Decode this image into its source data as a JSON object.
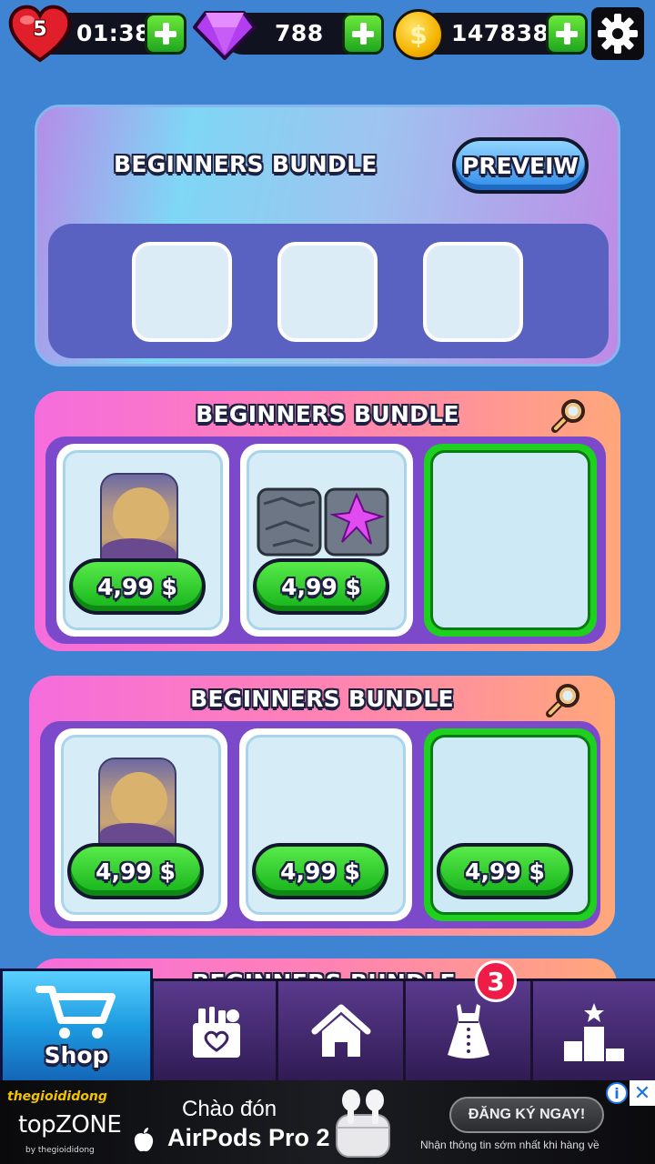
{
  "topbar": {
    "lives": "5",
    "timer": "01:38",
    "gems": "788",
    "coins": "147838",
    "coin_symbol": "$"
  },
  "preview_card": {
    "title": "BEGINNERS BUNDLE",
    "preview_label": "PREVEIW"
  },
  "bundles": [
    {
      "title": "BEGINNERS BUNDLE",
      "items": [
        {
          "price": "4,99 $"
        },
        {
          "price": "4,99 $"
        },
        {
          "price": ""
        }
      ]
    },
    {
      "title": "BEGINNERS BUNDLE",
      "items": [
        {
          "price": "4,99 $"
        },
        {
          "price": "4,99 $"
        },
        {
          "price": "4,99 $"
        }
      ]
    },
    {
      "title": "BEGINNERS BUNDLE"
    }
  ],
  "nav": {
    "shop_label": "Shop",
    "dress_badge": "3",
    "tabs": [
      "Shop",
      "gifts-icon",
      "home-icon",
      "dress-icon",
      "leaderboard-icon"
    ]
  },
  "ad": {
    "brand_top": "thegioididong",
    "brand_main": "topZONE",
    "brand_sub": "by thegioididong",
    "headline1": "Chào đón",
    "headline2": "AirPods Pro 2",
    "cta": "ĐĂNG KÝ NGAY!",
    "sub": "Nhận thông tin sớm nhất khi hàng về",
    "info": "i",
    "close": "✕"
  },
  "colors": {
    "background": "#3f84d2",
    "price_green": "#14b21a",
    "preview_blue": "#2f8be8",
    "badge_red": "#ef1c48"
  }
}
